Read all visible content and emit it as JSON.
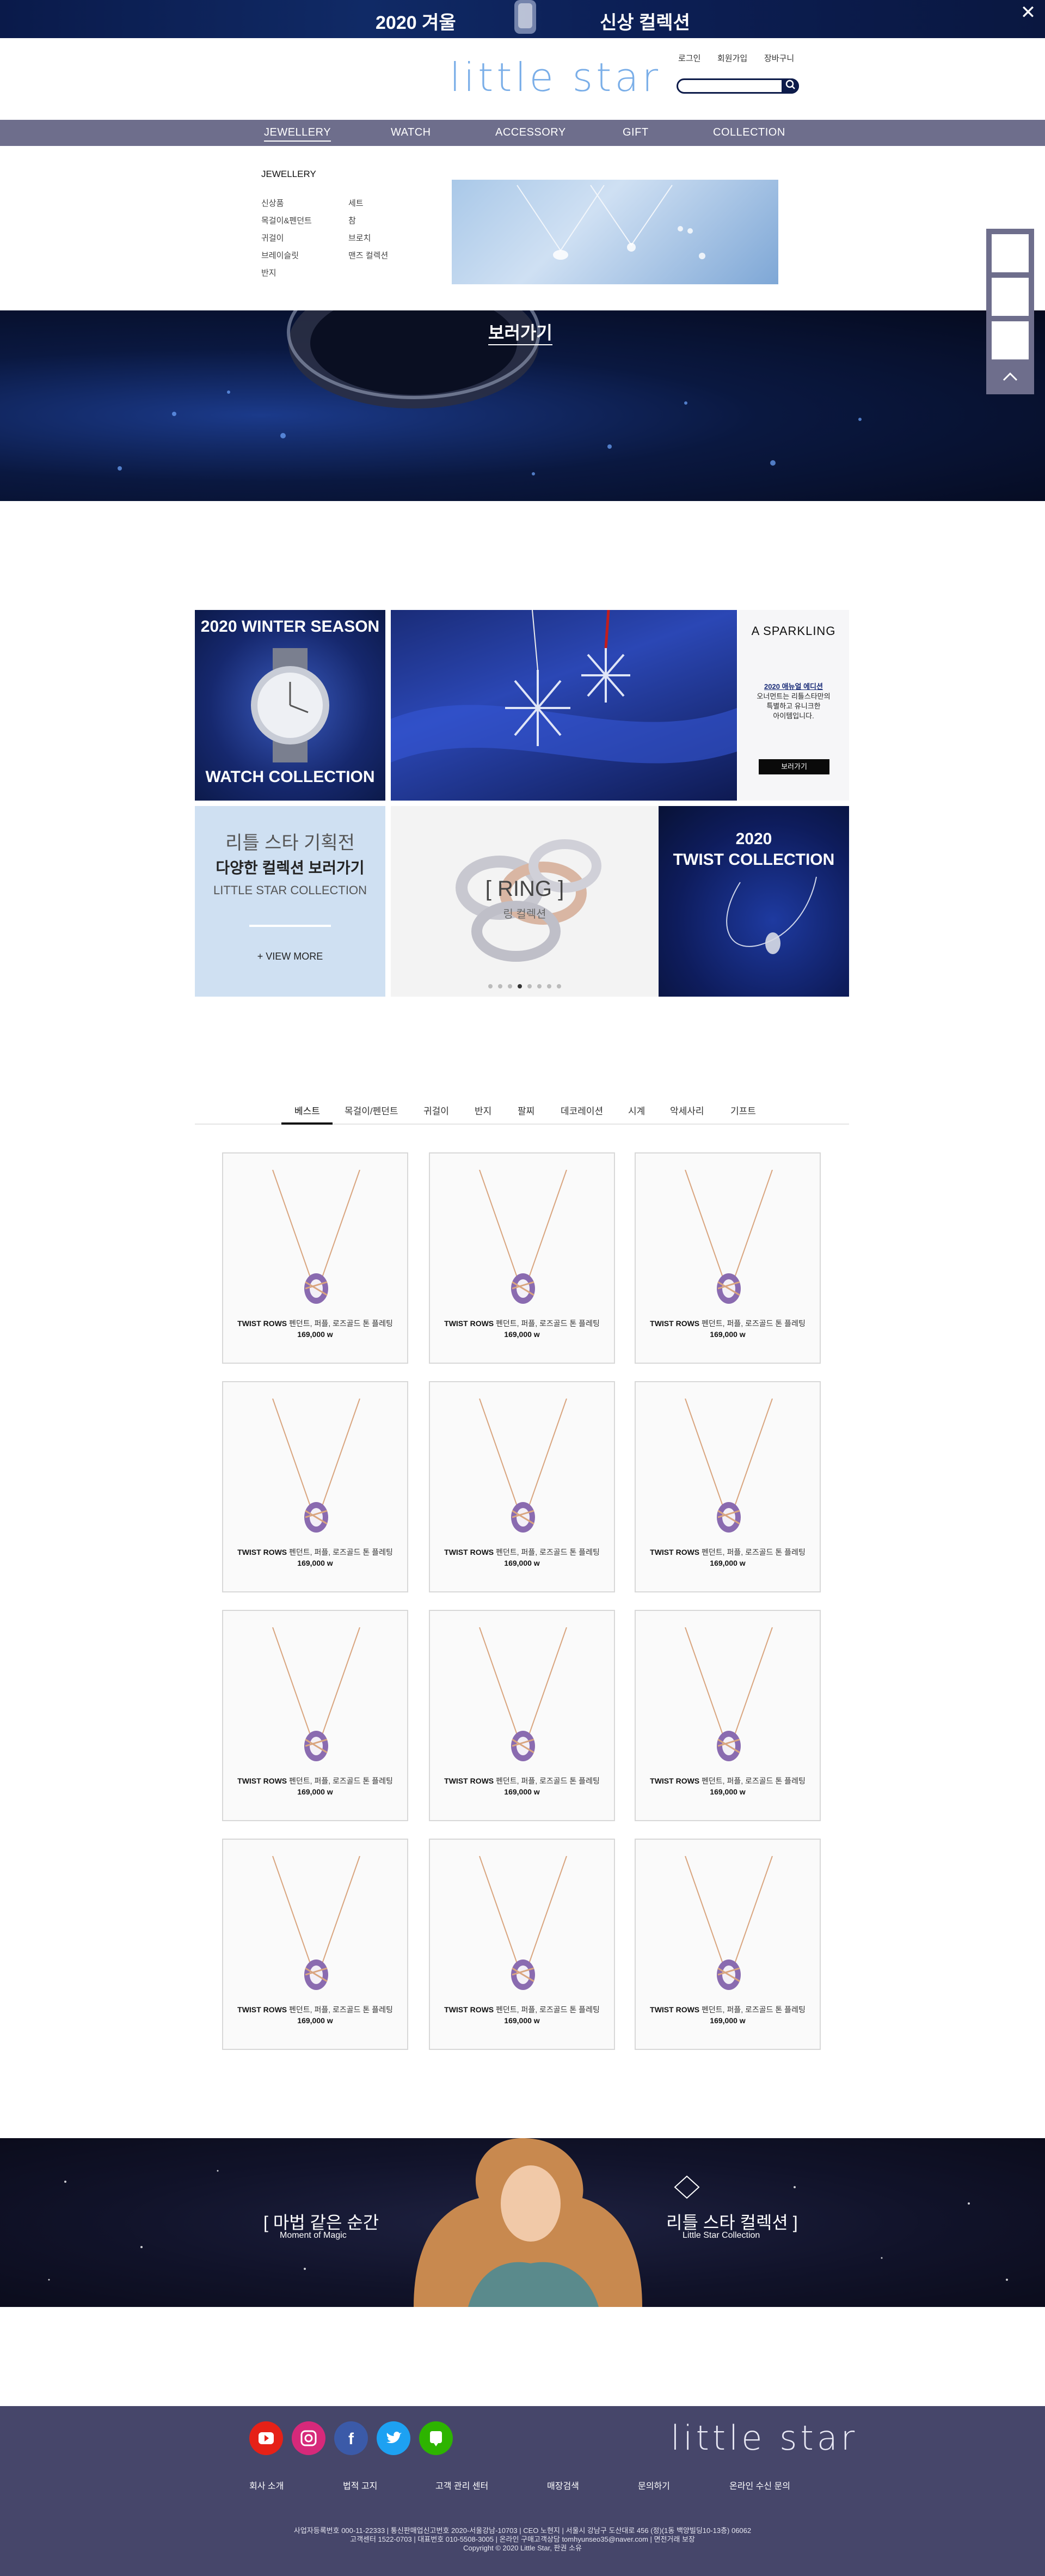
{
  "top_banner": {
    "left_text": "2020 겨울",
    "right_text": "신상 컬렉션",
    "close_icon": "close-icon"
  },
  "header": {
    "logo": "little star",
    "utility": [
      "로그인",
      "회원가입",
      "장바구니"
    ],
    "search": {
      "placeholder": "",
      "icon": "search-icon"
    }
  },
  "gnb": {
    "items": [
      "JEWELLERY",
      "WATCH",
      "ACCESSORY",
      "GIFT",
      "COLLECTION"
    ],
    "active_index": 0
  },
  "mega_menu": {
    "title": "JEWELLERY",
    "col1": [
      "신상품",
      "목걸이&펜던트",
      "귀걸이",
      "브레이슬릿",
      "반지"
    ],
    "col2": [
      "세트",
      "참",
      "브로치",
      "맨즈 컬렉션"
    ]
  },
  "hero": {
    "button": "보러가기"
  },
  "promos": {
    "watch": {
      "top": "2020 WINTER SEASON",
      "bottom": "WATCH COLLECTION"
    },
    "sparkling": {
      "title": "A SPARKLING",
      "highlight": "2020 애뉴얼 에디션",
      "lines": [
        "오너먼트는 리틀스타만의",
        "특별하고 유니크한",
        "아이템입니다."
      ],
      "button": "보러가기"
    },
    "plan": {
      "line1": "리틀 스타 기획전",
      "line2": "다양한 컬렉션 보러가기",
      "line3": "LITTLE STAR COLLECTION",
      "button": "+ VIEW MORE"
    },
    "ring": {
      "title": "[ RING ]",
      "sub": "링 컬렉션",
      "dots_total": 8,
      "dots_active": 3
    },
    "twist": {
      "line1": "2020",
      "line2": "TWIST COLLECTION"
    }
  },
  "tabs": {
    "items": [
      "베스트",
      "목걸이/펜던트",
      "귀걸이",
      "반지",
      "팔찌",
      "데코레이션",
      "시계",
      "악세사리",
      "기프트"
    ],
    "active_index": 0
  },
  "products": [
    {
      "name": "TWIST ROWS",
      "desc": "펜던트, 퍼플, 로즈골드 톤 플레팅",
      "price": "169,000 w"
    },
    {
      "name": "TWIST ROWS",
      "desc": "펜던트, 퍼플, 로즈골드 톤 플레팅",
      "price": "169,000 w"
    },
    {
      "name": "TWIST ROWS",
      "desc": "펜던트, 퍼플, 로즈골드 톤 플레팅",
      "price": "169,000 w"
    },
    {
      "name": "TWIST ROWS",
      "desc": "펜던트, 퍼플, 로즈골드 톤 플레팅",
      "price": "169,000 w"
    },
    {
      "name": "TWIST ROWS",
      "desc": "펜던트, 퍼플, 로즈골드 톤 플레팅",
      "price": "169,000 w"
    },
    {
      "name": "TWIST ROWS",
      "desc": "펜던트, 퍼플, 로즈골드 톤 플레팅",
      "price": "169,000 w"
    },
    {
      "name": "TWIST ROWS",
      "desc": "펜던트, 퍼플, 로즈골드 톤 플레팅",
      "price": "169,000 w"
    },
    {
      "name": "TWIST ROWS",
      "desc": "펜던트, 퍼플, 로즈골드 톤 플레팅",
      "price": "169,000 w"
    },
    {
      "name": "TWIST ROWS",
      "desc": "펜던트, 퍼플, 로즈골드 톤 플레팅",
      "price": "169,000 w"
    },
    {
      "name": "TWIST ROWS",
      "desc": "펜던트, 퍼플, 로즈골드 톤 플레팅",
      "price": "169,000 w"
    },
    {
      "name": "TWIST ROWS",
      "desc": "펜던트, 퍼플, 로즈골드 톤 플레팅",
      "price": "169,000 w"
    },
    {
      "name": "TWIST ROWS",
      "desc": "펜던트, 퍼플, 로즈골드 톤 플레팅",
      "price": "169,000 w"
    }
  ],
  "moment": {
    "left_title": "[ 마법 같은 순간",
    "left_sub": "Moment of Magic",
    "right_title": "리틀 스타 컬렉션 ]",
    "right_sub": "Little Star Collection"
  },
  "footer": {
    "sns": [
      "youtube-icon",
      "instagram-icon",
      "facebook-icon",
      "twitter-icon",
      "blog-icon"
    ],
    "logo": "little star",
    "nav": [
      "회사 소개",
      "법적 고지",
      "고객 관리 센터",
      "매장검색",
      "문의하기",
      "온라인 수신 문의"
    ],
    "info1": "사업자등록번호 000-11-22333  |  통신판매업신고번호 2020-서울강남-10703  |  CEO 노현지  |  서울시 강남구 도산대로 456 (정)(1동 백양빌딩10-13층) 06062",
    "info2": "고객센터 1522-0703  |  대표번호 010-5508-3005  |  온라인 구매고객상담 tomhyunseo35@naver.com  |  면전거래 보장",
    "info3": "Copyright © 2020 Little Star, 판권 소유"
  },
  "colors": {
    "navy": "#0d1b4a",
    "nav_bg": "#6e6e8c",
    "footer_bg": "#46466a",
    "logo_blue": "#7aaee8"
  }
}
